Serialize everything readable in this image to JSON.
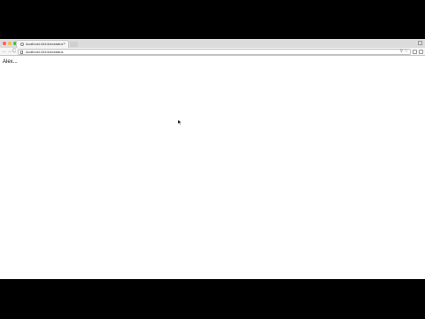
{
  "browser": {
    "tab": {
      "title": "localhost:4444/wxstatus",
      "close_glyph": "×"
    },
    "toolbar": {
      "back_glyph": "←",
      "forward_glyph": "→",
      "reload_glyph": "C",
      "url": "localhost:4444/wxstatus",
      "search_glyph": "🔍",
      "star_glyph": "☆"
    }
  },
  "page": {
    "text": "Alex..."
  },
  "colors": {
    "close": "#fc5f57",
    "minimize": "#fdbc2e",
    "maximize": "#33c748"
  }
}
